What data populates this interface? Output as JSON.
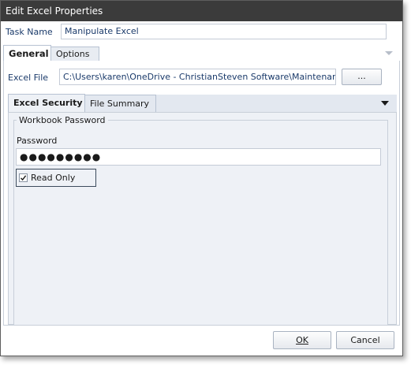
{
  "window": {
    "title": "Edit Excel Properties"
  },
  "task": {
    "label": "Task Name",
    "value": "Manipulate Excel"
  },
  "main_tabs": [
    {
      "label": "General"
    },
    {
      "label": "Options"
    }
  ],
  "excel_file": {
    "label": "Excel File",
    "value": "C:\\Users\\karen\\OneDrive - ChristianSteven Software\\Maintenance all p",
    "browse_label": "..."
  },
  "sub_tabs": [
    {
      "label": "Excel Security"
    },
    {
      "label": "File Summary"
    }
  ],
  "security": {
    "group_label": "Workbook Password",
    "password_label": "Password",
    "password_value": "●●●●●●●●●",
    "read_only_label": "Read Only",
    "read_only_checked": true
  },
  "footer": {
    "ok_label": "OK",
    "cancel_label": "Cancel"
  },
  "icons": {
    "tab_overflow": "chevron-down-icon",
    "subtab_overflow": "chevron-down-icon",
    "checkbox": "check-icon"
  },
  "colors": {
    "title_bar": "#3b3b3b",
    "label_text": "#1a3a6a",
    "focus_border": "#3c4b5c"
  }
}
